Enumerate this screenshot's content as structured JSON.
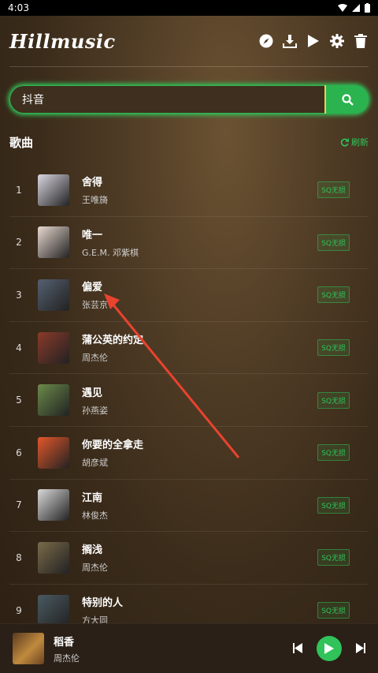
{
  "status": {
    "time": "4:03"
  },
  "header": {
    "logo": "Hillmusic",
    "actions": [
      "compass-icon",
      "download-icon",
      "play-icon",
      "gear-icon",
      "trash-icon"
    ]
  },
  "search": {
    "value": "抖音"
  },
  "section": {
    "title": "歌曲",
    "refresh_label": "刷新"
  },
  "colors": {
    "accent": "#2fc35a",
    "search_sep": "#e9d24a"
  },
  "songs": [
    {
      "index": "1",
      "title": "舍得",
      "artist": "王唯旖",
      "badge": "SQ无损",
      "cover_color": "#d9d6e0"
    },
    {
      "index": "2",
      "title": "唯一",
      "artist": "G.E.M. 邓紫棋",
      "badge": "SQ无损",
      "cover_color": "#e8d9d0"
    },
    {
      "index": "3",
      "title": "偏爱",
      "artist": "张芸京",
      "badge": "SQ无损",
      "cover_color": "#556070"
    },
    {
      "index": "4",
      "title": "蒲公英的约定",
      "artist": "周杰伦",
      "badge": "SQ无损",
      "cover_color": "#8a3a2a"
    },
    {
      "index": "5",
      "title": "遇见",
      "artist": "孙燕姿",
      "badge": "SQ无损",
      "cover_color": "#6b8a4a"
    },
    {
      "index": "6",
      "title": "你要的全拿走",
      "artist": "胡彦斌",
      "badge": "SQ无损",
      "cover_color": "#e2572a"
    },
    {
      "index": "7",
      "title": "江南",
      "artist": "林俊杰",
      "badge": "SQ无损",
      "cover_color": "#d9d9d9"
    },
    {
      "index": "8",
      "title": "搁浅",
      "artist": "周杰伦",
      "badge": "SQ无损",
      "cover_color": "#7a6a4a"
    },
    {
      "index": "9",
      "title": "特别的人",
      "artist": "方大同",
      "badge": "SQ无损",
      "cover_color": "#4a5a62"
    }
  ],
  "player": {
    "title": "稻香",
    "artist": "周杰伦"
  }
}
